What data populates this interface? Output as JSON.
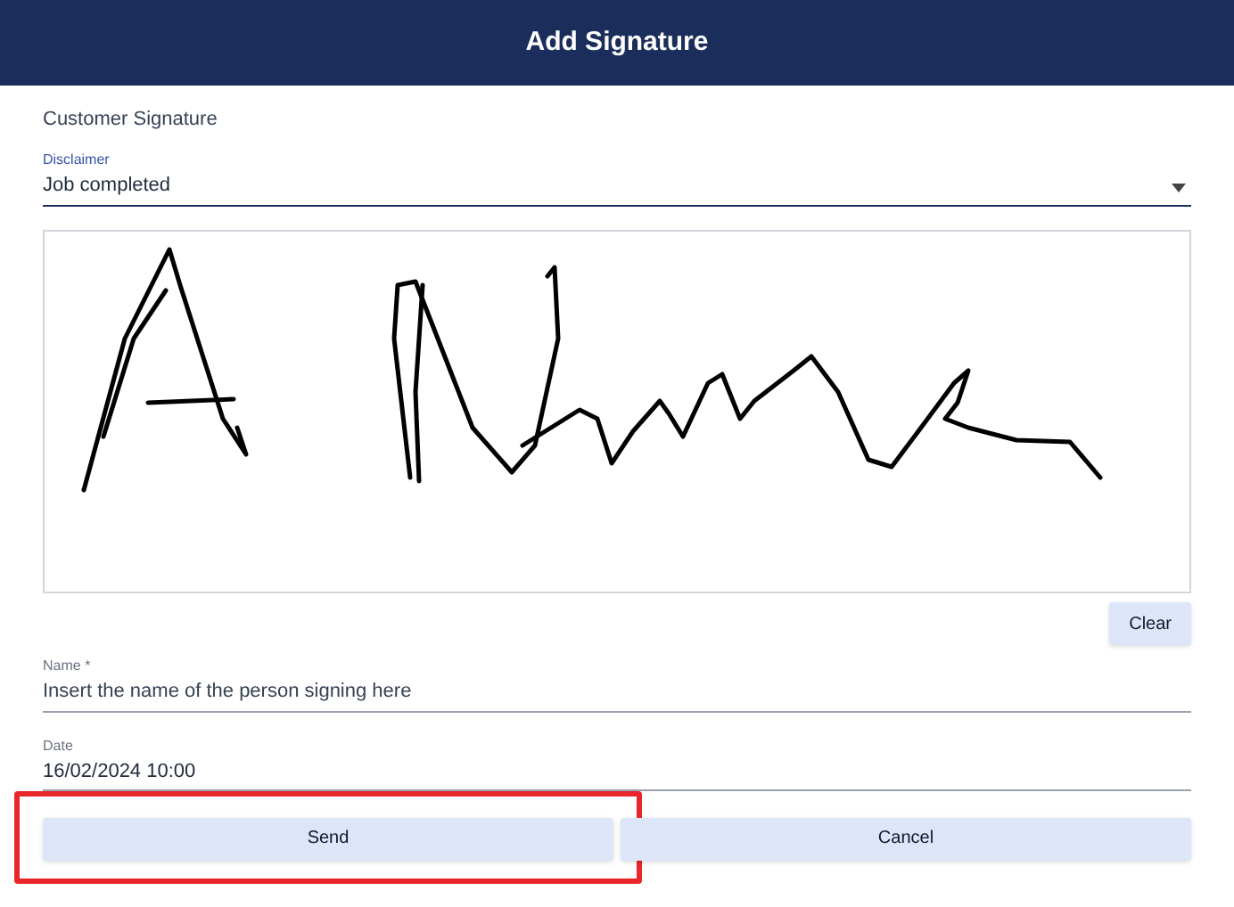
{
  "header": {
    "title": "Add Signature"
  },
  "section_label": "Customer Signature",
  "disclaimer": {
    "label": "Disclaimer",
    "value": "Job completed"
  },
  "signature_pad": {
    "clear_button": "Clear"
  },
  "name_field": {
    "label": "Name *",
    "placeholder": "Insert the name of the person signing here"
  },
  "date_field": {
    "label": "Date",
    "value": "16/02/2024 10:00"
  },
  "buttons": [
    {
      "label": "Send",
      "highlighted": true
    },
    {
      "label": "Cancel",
      "highlighted": false
    }
  ]
}
